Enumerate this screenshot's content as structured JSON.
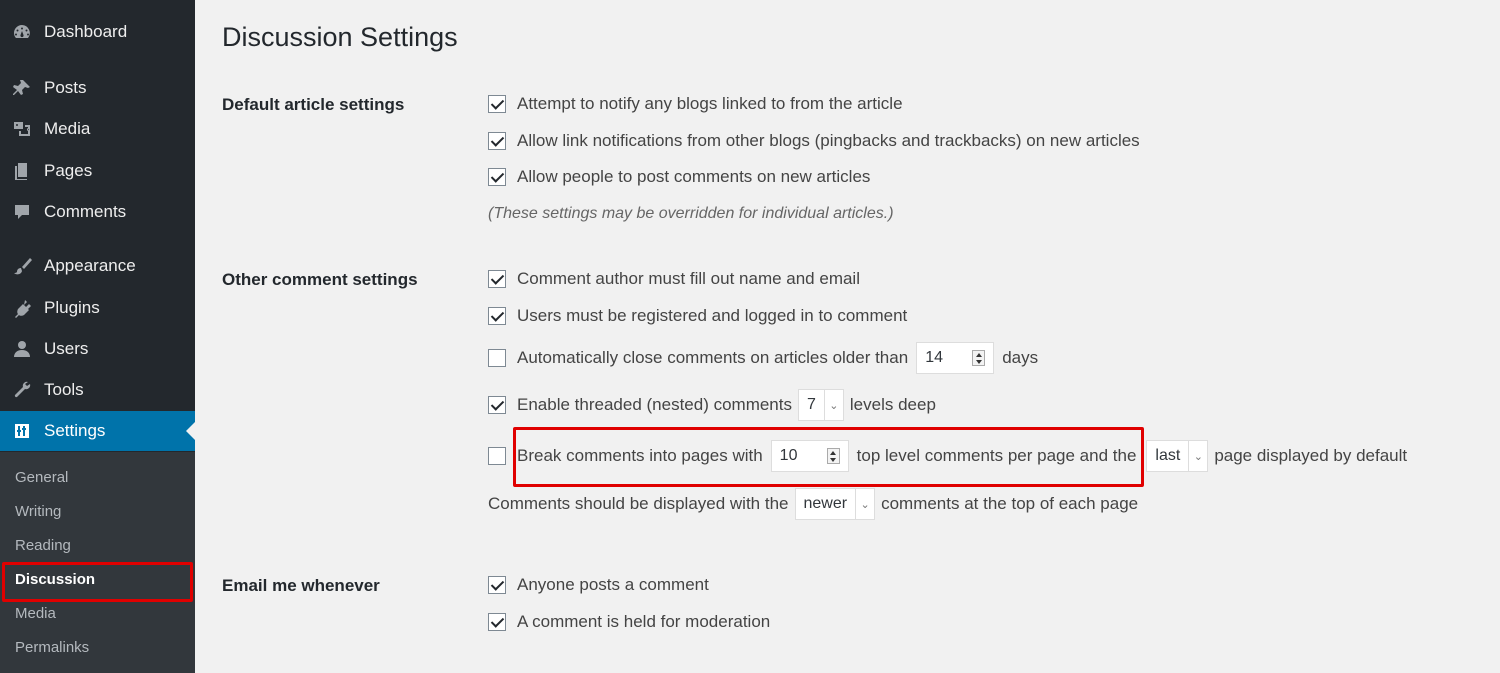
{
  "sidebar": {
    "menu": [
      {
        "label": "Dashboard",
        "icon": "dashboard-icon"
      },
      {
        "label": "Posts",
        "icon": "pushpin-icon"
      },
      {
        "label": "Media",
        "icon": "media-icon"
      },
      {
        "label": "Pages",
        "icon": "pages-icon"
      },
      {
        "label": "Comments",
        "icon": "comment-icon"
      },
      {
        "label": "Appearance",
        "icon": "paintbrush-icon"
      },
      {
        "label": "Plugins",
        "icon": "plugin-icon"
      },
      {
        "label": "Users",
        "icon": "user-icon"
      },
      {
        "label": "Tools",
        "icon": "wrench-icon"
      },
      {
        "label": "Settings",
        "icon": "settings-sliders-icon"
      }
    ],
    "submenu": [
      "General",
      "Writing",
      "Reading",
      "Discussion",
      "Media",
      "Permalinks"
    ],
    "active_color": "#0073aa",
    "highlight_color": "#e00000"
  },
  "page": {
    "title": "Discussion Settings",
    "default_article": {
      "label": "Default article settings",
      "options": [
        {
          "text": "Attempt to notify any blogs linked to from the article",
          "checked": true
        },
        {
          "text": "Allow link notifications from other blogs (pingbacks and trackbacks) on new articles",
          "checked": true
        },
        {
          "text": "Allow people to post comments on new articles",
          "checked": true
        }
      ],
      "note": "(These settings may be overridden for individual articles.)"
    },
    "other_comment": {
      "label": "Other comment settings",
      "author_fill": {
        "text": "Comment author must fill out name and email",
        "checked": true
      },
      "registered": {
        "text": "Users must be registered and logged in to comment",
        "checked": true
      },
      "auto_close": {
        "text_before": "Automatically close comments on articles older than",
        "value": "14",
        "text_after": "days",
        "checked": false
      },
      "threaded": {
        "text_before": "Enable threaded (nested) comments",
        "value": "7",
        "text_after": "levels deep",
        "checked": true
      },
      "paging": {
        "text_before": "Break comments into pages with",
        "value": "10",
        "text_middle": "top level comments per page and the",
        "select_value": "last",
        "text_after": "page displayed by default",
        "checked": false
      },
      "order": {
        "text_before": "Comments should be displayed with the",
        "select_value": "newer",
        "text_after": "comments at the top of each page"
      }
    },
    "email": {
      "label": "Email me whenever",
      "options": [
        {
          "text": "Anyone posts a comment",
          "checked": true
        },
        {
          "text": "A comment is held for moderation",
          "checked": true
        }
      ]
    }
  }
}
